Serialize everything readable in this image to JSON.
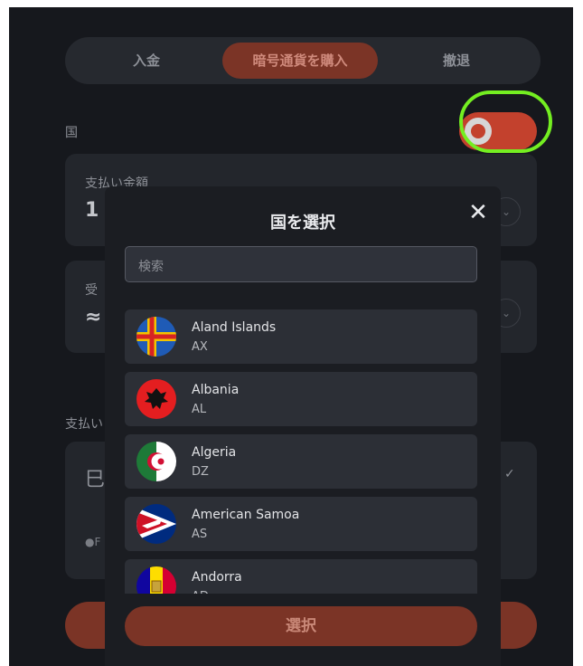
{
  "tabs": [
    {
      "label": "入金"
    },
    {
      "label": "暗号通貨を購入",
      "active": true
    },
    {
      "label": "撤退"
    }
  ],
  "country_label": "国",
  "toggle": {
    "on": true,
    "color": "#c3412d"
  },
  "highlight_color": "#74ee21",
  "payment_card": {
    "label": "支払い金額",
    "amount_prefix": "1"
  },
  "receive_card": {
    "label": "受",
    "amount_prefix": "≈"
  },
  "payment_method_label": "支払い",
  "method_card": {
    "icon": "card-icon",
    "glyph": "巳",
    "sub": "●F",
    "check": "✓"
  },
  "modal": {
    "title": "国を選択",
    "close_icon": "close-icon",
    "search_placeholder": "検索",
    "countries": [
      {
        "name": "Aland Islands",
        "code": "AX",
        "flag": "aland-islands-flag"
      },
      {
        "name": "Albania",
        "code": "AL",
        "flag": "albania-flag"
      },
      {
        "name": "Algeria",
        "code": "DZ",
        "flag": "algeria-flag"
      },
      {
        "name": "American Samoa",
        "code": "AS",
        "flag": "american-samoa-flag"
      },
      {
        "name": "Andorra",
        "code": "AD",
        "flag": "andorra-flag"
      }
    ],
    "select_label": "選択"
  },
  "colors": {
    "accent": "#7b3426",
    "background": "#16181d",
    "card": "#2c2f36"
  }
}
